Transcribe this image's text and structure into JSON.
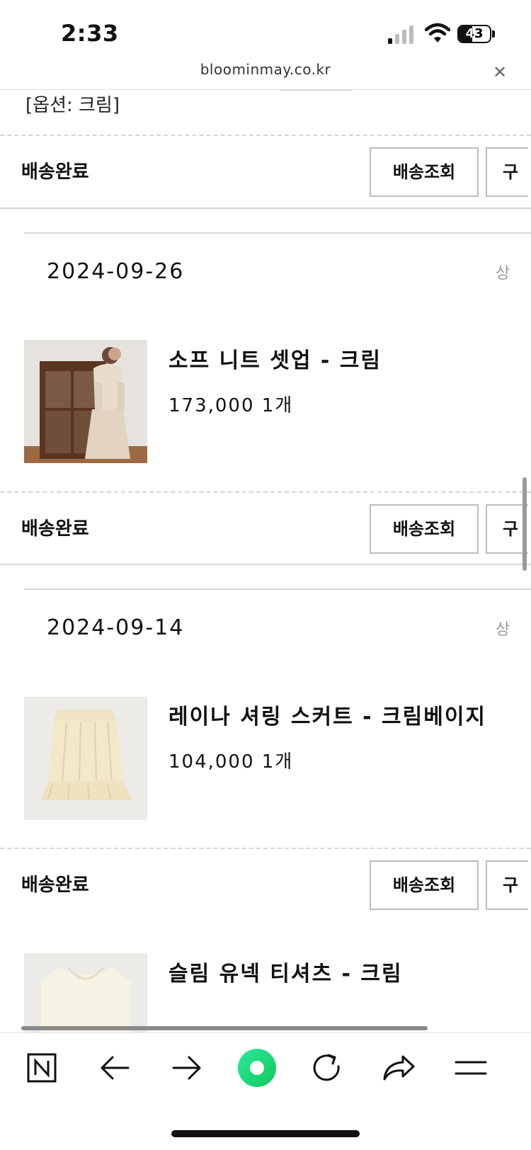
{
  "status_bar": {
    "time": "2:33",
    "battery": "43",
    "battery_level": 0.43
  },
  "address_bar": {
    "url": "bloominmay.co.kr",
    "close_icon": "close-icon"
  },
  "top_option": "[옵션: 크림]",
  "orders": [
    {
      "status": "배송완료",
      "track_label": "배송조회",
      "second_label": "구"
    },
    {
      "date": "2024-09-26",
      "detail_label": "상",
      "product": {
        "name": "소프 니트 셋업 - 크림",
        "price": "173,000",
        "qty": "1개"
      },
      "status": "배송완료",
      "track_label": "배송조회",
      "second_label": "구"
    },
    {
      "date": "2024-09-14",
      "detail_label": "상",
      "product": {
        "name": "레이나 셔링 스커트 - 크림베이지",
        "price": "104,000",
        "qty": "1개"
      },
      "status": "배송완료",
      "track_label": "배송조회",
      "second_label": "구"
    },
    {
      "product": {
        "name": "슬림 유넥 티셔츠 - 크림"
      }
    }
  ],
  "toolbar": {
    "icons": [
      "naver-n-icon",
      "back-arrow-icon",
      "forward-arrow-icon",
      "green-record-icon",
      "refresh-icon",
      "share-icon",
      "menu-icon"
    ],
    "accent": "#19d67a"
  }
}
